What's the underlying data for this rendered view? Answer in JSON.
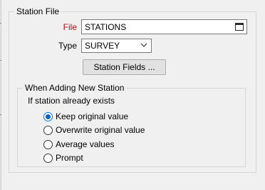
{
  "station_file": {
    "group_title": "Station File",
    "file_label": "File",
    "file_value": "STATIONS",
    "file_browse_icon": "browse-icon",
    "type_label": "Type",
    "type_value": "SURVEY",
    "station_fields_button": "Station Fields ...",
    "colors": {
      "file_label": "#a31515",
      "accent": "#0078d7"
    }
  },
  "when_adding": {
    "group_title": "When Adding New Station",
    "condition_label": "If station already exists",
    "options": [
      {
        "label": "Keep original value",
        "selected": true
      },
      {
        "label": "Overwrite original value",
        "selected": false
      },
      {
        "label": "Average values",
        "selected": false
      },
      {
        "label": "Prompt",
        "selected": false
      }
    ]
  }
}
